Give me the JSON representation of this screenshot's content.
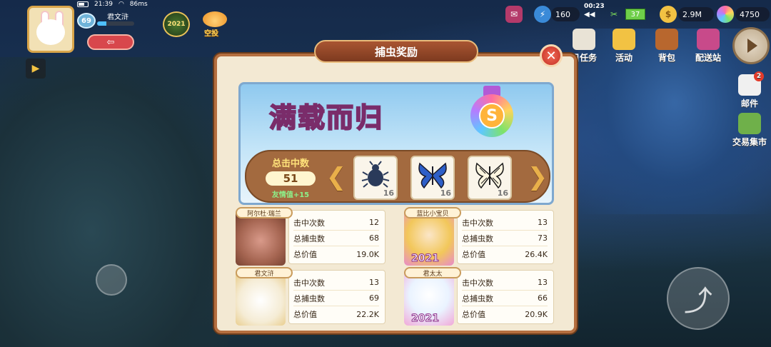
{
  "status": {
    "time": "21:39",
    "speed": "86ms"
  },
  "player": {
    "name": "君文浒",
    "level": "69",
    "exit_label": "⇦"
  },
  "badges": {
    "year": "2021",
    "airdrop": "空投"
  },
  "resources": {
    "timer": "00:23",
    "stamina": "160",
    "speed": "◀◀",
    "meter": "37",
    "coins": "2.9M",
    "gems": "4750"
  },
  "menu": {
    "tasks": "日任务",
    "activity": "活动",
    "bag": "背包",
    "delivery": "配送站",
    "mail": "邮件",
    "mail_count": "2",
    "market": "交易集市"
  },
  "dialog": {
    "title": "捕虫奖励",
    "close": "✕",
    "banner_title": "满载而归",
    "rank": "S",
    "hit_label": "总击中数",
    "hit_value": "51",
    "friend": "友情值+15",
    "bugs": [
      {
        "name": "beetle",
        "count": "16"
      },
      {
        "name": "blue-butterfly",
        "count": "16"
      },
      {
        "name": "white-butterfly",
        "count": "16"
      }
    ],
    "players": [
      {
        "name": "阿尔杜·瑞兰",
        "hits": "12",
        "caught": "68",
        "value": "19.0K"
      },
      {
        "name": "蓝比小宝贝",
        "hits": "13",
        "caught": "73",
        "value": "26.4K"
      },
      {
        "name": "君文浒",
        "hits": "13",
        "caught": "69",
        "value": "22.2K"
      },
      {
        "name": "君太太",
        "hits": "13",
        "caught": "66",
        "value": "20.9K"
      }
    ],
    "labels": {
      "hits": "击中次数",
      "caught": "总捕虫数",
      "value": "总价值"
    },
    "portrait_year": "2021"
  }
}
